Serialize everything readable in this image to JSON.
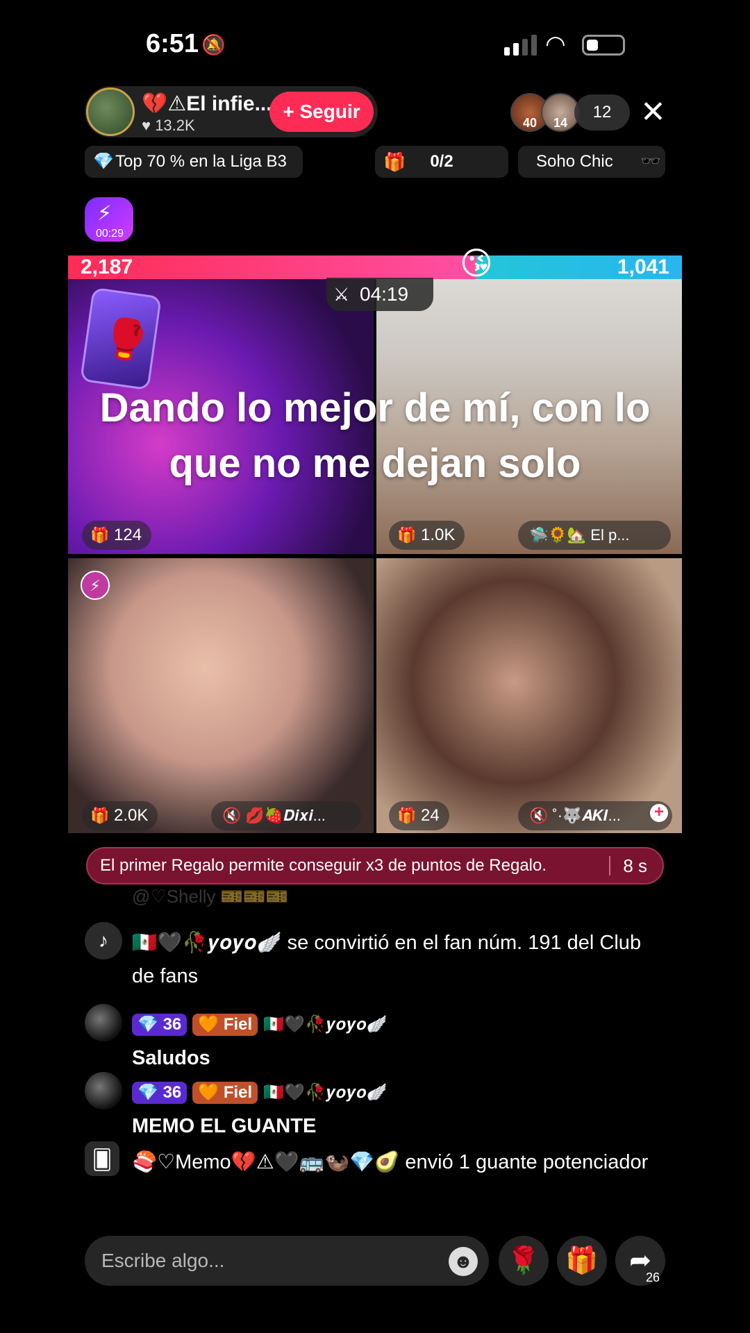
{
  "status_bar": {
    "time": "6:51",
    "bell": "🔕"
  },
  "host": {
    "name": "💔⚠El infie...",
    "likes": "13.2K",
    "follow_label": "+ Seguir"
  },
  "viewers": {
    "badge1": "40",
    "badge2": "14",
    "count": "12"
  },
  "info": {
    "league": "Top 70 % en la Liga B3",
    "goal": "0/2",
    "chic": "Soho Chic"
  },
  "boost_timer": "00:29",
  "battle": {
    "left_score": "2,187",
    "right_score": "1,041",
    "timer": "04:19",
    "left_fraction": 0.665
  },
  "overlay_text": "Dando lo mejor de mí, con lo que no me dejan solo",
  "tiles": [
    {
      "score": "124",
      "name": ""
    },
    {
      "score": "1.0K",
      "name": "🛸🌻🏡 El p..."
    },
    {
      "score": "2.0K",
      "name": "💋🍓𝑫𝒊𝒙𝒊..."
    },
    {
      "score": "24",
      "name": "˚·🐺𝑨𝑲𝑰..."
    }
  ],
  "banner": {
    "text": "El primer Regalo permite conseguir x3 de puntos de Regalo.",
    "seconds": "8 s"
  },
  "chat": {
    "ghost": "@♡Shelly 🎫🎫🎫",
    "msg1": "🇲🇽🖤🥀𝒚𝒐𝒚𝒐🪽 se convirtió en el fan núm. 191 del Club de fans",
    "msg2_user": "🇲🇽🖤🥀𝒚𝒐𝒚𝒐🪽",
    "msg2": "Saludos",
    "msg3_user": "🇲🇽🖤🥀𝒚𝒐𝒚𝒐🪽",
    "msg3": "MEMO EL GUANTE",
    "msg4": "🍣♡Memo💔⚠🖤🚌🦦💎🥑 envió 1 guante potenciador",
    "badge_level": "36",
    "badge_fiel": "Fiel"
  },
  "input": {
    "placeholder": "Escribe algo..."
  },
  "share_count": "26"
}
